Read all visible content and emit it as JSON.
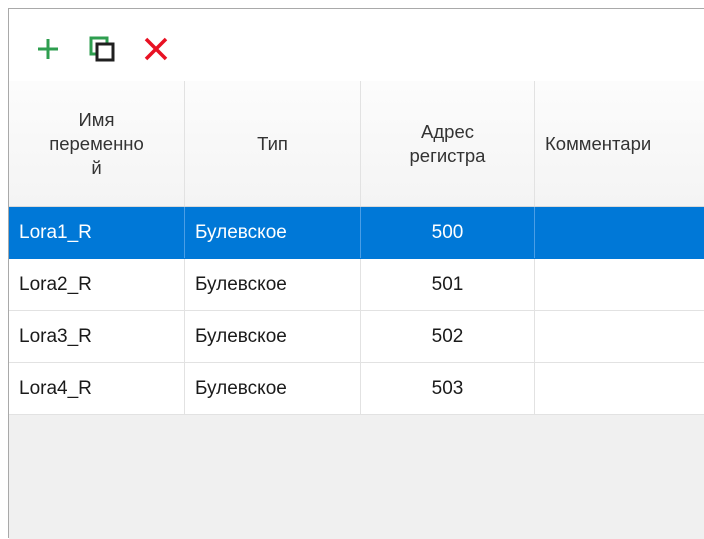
{
  "toolbar": {
    "add_icon": "plus-icon",
    "copy_icon": "duplicate-icon",
    "delete_icon": "close-icon",
    "colors": {
      "add": "#2e9e4f",
      "copy": "#1f1f1f",
      "delete": "#e81123"
    }
  },
  "table": {
    "headers": {
      "name": "Имя\nпеременно\nй",
      "type": "Тип",
      "address": "Адрес\nрегистра",
      "comment": "Комментари"
    },
    "rows": [
      {
        "name": "Lora1_R",
        "type": "Булевское",
        "address": "500",
        "comment": "",
        "selected": true
      },
      {
        "name": "Lora2_R",
        "type": "Булевское",
        "address": "501",
        "comment": ""
      },
      {
        "name": "Lora3_R",
        "type": "Булевское",
        "address": "502",
        "comment": ""
      },
      {
        "name": "Lora4_R",
        "type": "Булевское",
        "address": "503",
        "comment": ""
      }
    ],
    "selection_color": "#0078d7"
  }
}
